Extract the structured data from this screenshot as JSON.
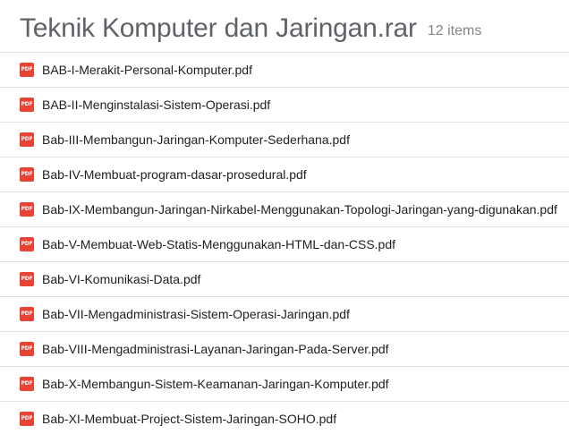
{
  "archive": {
    "title": "Teknik Komputer dan Jaringan.rar",
    "count": "12 items"
  },
  "files": [
    {
      "name": "BAB-I-Merakit-Personal-Komputer.pdf",
      "icon": "pdf-icon",
      "icon_label": "PDF"
    },
    {
      "name": "BAB-II-Menginstalasi-Sistem-Operasi.pdf",
      "icon": "pdf-icon",
      "icon_label": "PDF"
    },
    {
      "name": "Bab-III-Membangun-Jaringan-Komputer-Sederhana.pdf",
      "icon": "pdf-icon",
      "icon_label": "PDF"
    },
    {
      "name": "Bab-IV-Membuat-program-dasar-prosedural.pdf",
      "icon": "pdf-icon",
      "icon_label": "PDF"
    },
    {
      "name": "Bab-IX-Membangun-Jaringan-Nirkabel-Menggunakan-Topologi-Jaringan-yang-digunakan.pdf",
      "icon": "pdf-icon",
      "icon_label": "PDF"
    },
    {
      "name": "Bab-V-Membuat-Web-Statis-Menggunakan-HTML-dan-CSS.pdf",
      "icon": "pdf-icon",
      "icon_label": "PDF"
    },
    {
      "name": "Bab-VI-Komunikasi-Data.pdf",
      "icon": "pdf-icon",
      "icon_label": "PDF"
    },
    {
      "name": "Bab-VII-Mengadministrasi-Sistem-Operasi-Jaringan.pdf",
      "icon": "pdf-icon",
      "icon_label": "PDF"
    },
    {
      "name": "Bab-VIII-Mengadministrasi-Layanan-Jaringan-Pada-Server.pdf",
      "icon": "pdf-icon",
      "icon_label": "PDF"
    },
    {
      "name": "Bab-X-Membangun-Sistem-Keamanan-Jaringan-Komputer.pdf",
      "icon": "pdf-icon",
      "icon_label": "PDF"
    },
    {
      "name": "Bab-XI-Membuat-Project-Sistem-Jaringan-SOHO.pdf",
      "icon": "pdf-icon",
      "icon_label": "PDF"
    }
  ],
  "colors": {
    "pdf_icon": "#e94335",
    "title": "#5f6368",
    "divider": "#e0e0e0"
  }
}
